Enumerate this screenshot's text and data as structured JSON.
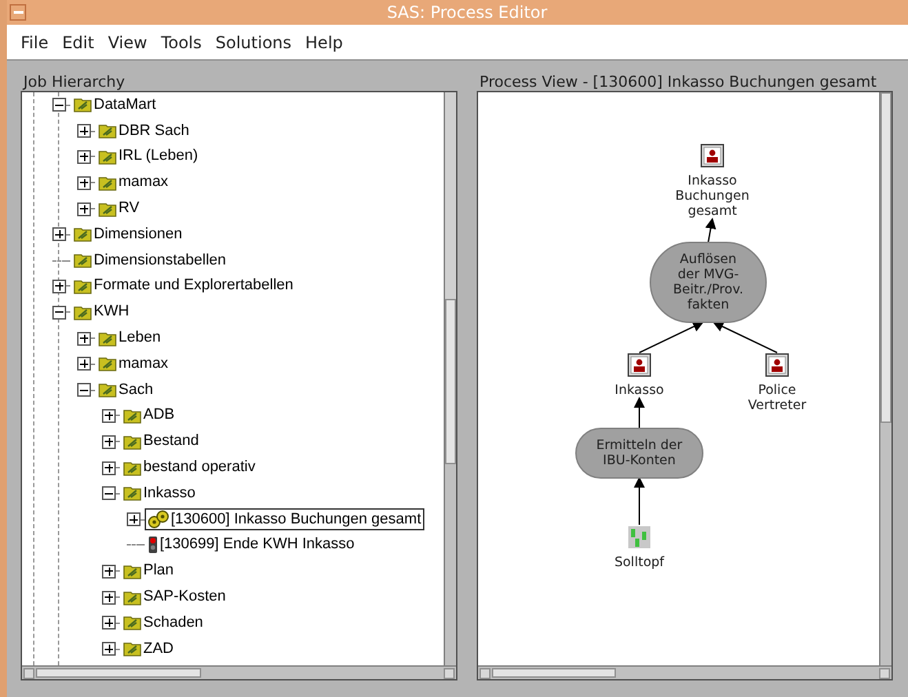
{
  "window": {
    "title": "SAS: Process Editor"
  },
  "menu": [
    "File",
    "Edit",
    "View",
    "Tools",
    "Solutions",
    "Help"
  ],
  "hierarchy": {
    "title": "Job Hierarchy",
    "items": [
      {
        "label": "DataMart",
        "kind": "folder",
        "expanded": true,
        "selected": false,
        "children": [
          {
            "label": "DBR Sach",
            "kind": "folder",
            "expanded": false,
            "selected": false
          },
          {
            "label": "IRL (Leben)",
            "kind": "folder",
            "expanded": false,
            "selected": false
          },
          {
            "label": "mamax",
            "kind": "folder",
            "expanded": false,
            "selected": false
          },
          {
            "label": "RV",
            "kind": "folder",
            "expanded": false,
            "selected": false
          }
        ]
      },
      {
        "label": "Dimensionen",
        "kind": "folder",
        "expanded": false,
        "selected": false
      },
      {
        "label": "Dimensionstabellen",
        "kind": "folder",
        "selected": false
      },
      {
        "label": "Formate und Explorertabellen",
        "kind": "folder",
        "expanded": false,
        "selected": false
      },
      {
        "label": "KWH",
        "kind": "folder",
        "expanded": true,
        "selected": false,
        "children": [
          {
            "label": "Leben",
            "kind": "folder",
            "expanded": false,
            "selected": false
          },
          {
            "label": "mamax",
            "kind": "folder",
            "expanded": false,
            "selected": false
          },
          {
            "label": "Sach",
            "kind": "folder",
            "expanded": true,
            "selected": false,
            "children": [
              {
                "label": "ADB",
                "kind": "folder",
                "expanded": false,
                "selected": false
              },
              {
                "label": "Bestand",
                "kind": "folder",
                "expanded": false,
                "selected": false
              },
              {
                "label": "bestand operativ",
                "kind": "folder",
                "expanded": false,
                "selected": false
              },
              {
                "label": "Inkasso",
                "kind": "folder",
                "expanded": true,
                "selected": false,
                "children": [
                  {
                    "label": "[130600] Inkasso Buchungen gesamt",
                    "kind": "job",
                    "expanded": false,
                    "selected": true
                  },
                  {
                    "label": "[130699] Ende KWH Inkasso",
                    "kind": "stop",
                    "selected": false
                  }
                ]
              },
              {
                "label": "Plan",
                "kind": "folder",
                "expanded": false,
                "selected": false
              },
              {
                "label": "SAP-Kosten",
                "kind": "folder",
                "expanded": false,
                "selected": false
              },
              {
                "label": "Schaden",
                "kind": "folder",
                "expanded": false,
                "selected": false
              },
              {
                "label": "ZAD",
                "kind": "folder",
                "expanded": false,
                "selected": false
              }
            ]
          }
        ]
      }
    ]
  },
  "process_view": {
    "title": "Process View - [130600] Inkasso Buchungen gesamt",
    "nodes": [
      {
        "kind": "table",
        "lines": [
          "Inkasso",
          "Buchungen",
          "gesamt"
        ]
      },
      {
        "kind": "step",
        "lines": [
          "Auflösen",
          "der MVG-",
          "Beitr./Prov.",
          "fakten"
        ]
      },
      {
        "kind": "table",
        "lines": [
          "Inkasso"
        ]
      },
      {
        "kind": "table",
        "lines": [
          "Police",
          "Vertreter"
        ]
      },
      {
        "kind": "step",
        "lines": [
          "Ermitteln der",
          "IBU-Konten"
        ]
      },
      {
        "kind": "source",
        "lines": [
          "Solltopf"
        ]
      }
    ]
  }
}
